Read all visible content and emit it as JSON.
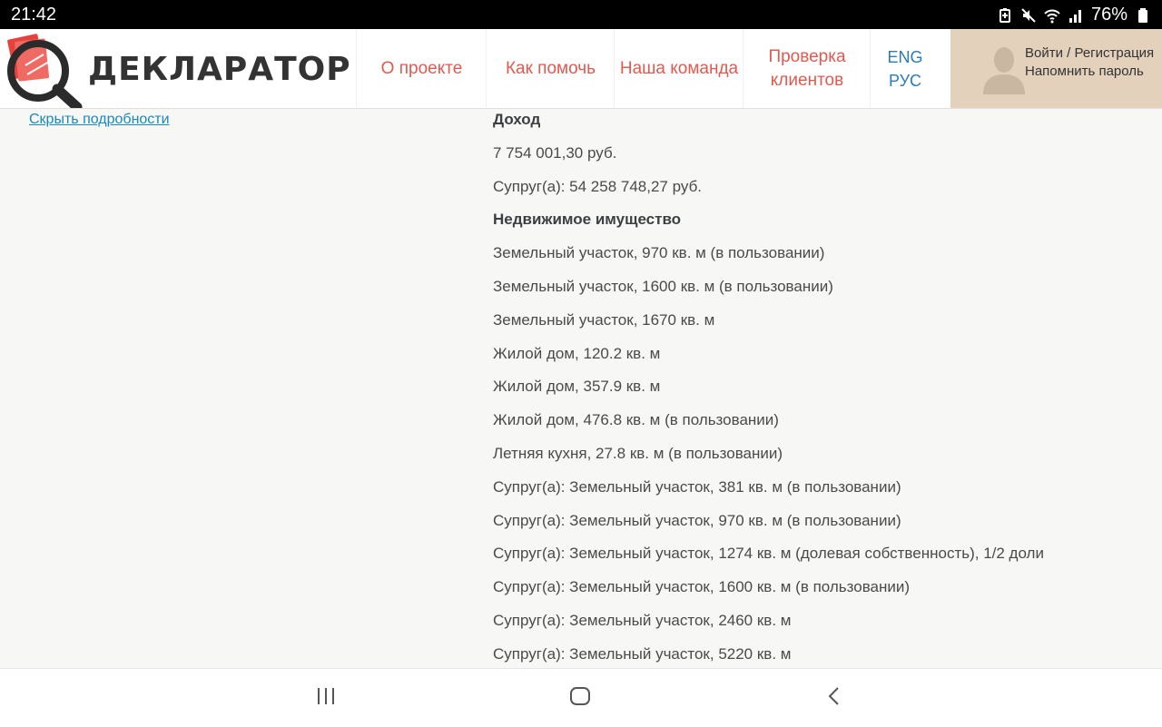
{
  "status_bar": {
    "time": "21:42",
    "battery": "76%"
  },
  "header": {
    "logo_text": "ДЕКЛАРАТОР",
    "nav": {
      "about": "О проекте",
      "help": "Как помочь",
      "team": "Наша команда",
      "clients_line1": "Проверка",
      "clients_line2": "клиентов",
      "lang_en": "ENG",
      "lang_ru": "РУС"
    },
    "user": {
      "login": "Войти / Регистрация",
      "remind": "Напомнить пароль"
    }
  },
  "content": {
    "hide_details": "Скрыть подробности",
    "rows": [
      {
        "text": "Доход",
        "type": "head"
      },
      {
        "text": "7 754 001,30 руб.",
        "type": "item"
      },
      {
        "text": "Супруг(а): 54 258 748,27 руб.",
        "type": "item"
      },
      {
        "text": "Недвижимое имущество",
        "type": "head"
      },
      {
        "text": "Земельный участок, 970 кв. м (в пользовании)",
        "type": "item"
      },
      {
        "text": "Земельный участок, 1600 кв. м (в пользовании)",
        "type": "item"
      },
      {
        "text": "Земельный участок, 1670 кв. м",
        "type": "item"
      },
      {
        "text": "Жилой дом, 120.2 кв. м",
        "type": "item"
      },
      {
        "text": "Жилой дом, 357.9 кв. м",
        "type": "item"
      },
      {
        "text": "Жилой дом, 476.8 кв. м (в пользовании)",
        "type": "item"
      },
      {
        "text": "Летняя кухня, 27.8 кв. м (в пользовании)",
        "type": "item"
      },
      {
        "text": "Супруг(а): Земельный участок, 381 кв. м (в пользовании)",
        "type": "item"
      },
      {
        "text": "Супруг(а): Земельный участок, 970 кв. м (в пользовании)",
        "type": "item"
      },
      {
        "text": "Супруг(а): Земельный участок, 1274 кв. м (долевая собственность), 1/2 доли",
        "type": "item"
      },
      {
        "text": "Супруг(а): Земельный участок, 1600 кв. м (в пользовании)",
        "type": "item"
      },
      {
        "text": "Супруг(а): Земельный участок, 2460 кв. м",
        "type": "item"
      },
      {
        "text": "Супруг(а): Земельный участок, 5220 кв. м",
        "type": "item"
      }
    ]
  },
  "colors": {
    "accent": "#e05a50",
    "link": "#1a8bb8",
    "lang": "#2d7bb8",
    "user_bg": "#e3d1bb"
  },
  "icons": [
    "battery-saver-icon",
    "mute-icon",
    "wifi-icon",
    "signal-icon",
    "battery-icon",
    "magnifier-logo-icon",
    "avatar-icon",
    "recent-apps-icon",
    "home-icon",
    "back-icon"
  ]
}
